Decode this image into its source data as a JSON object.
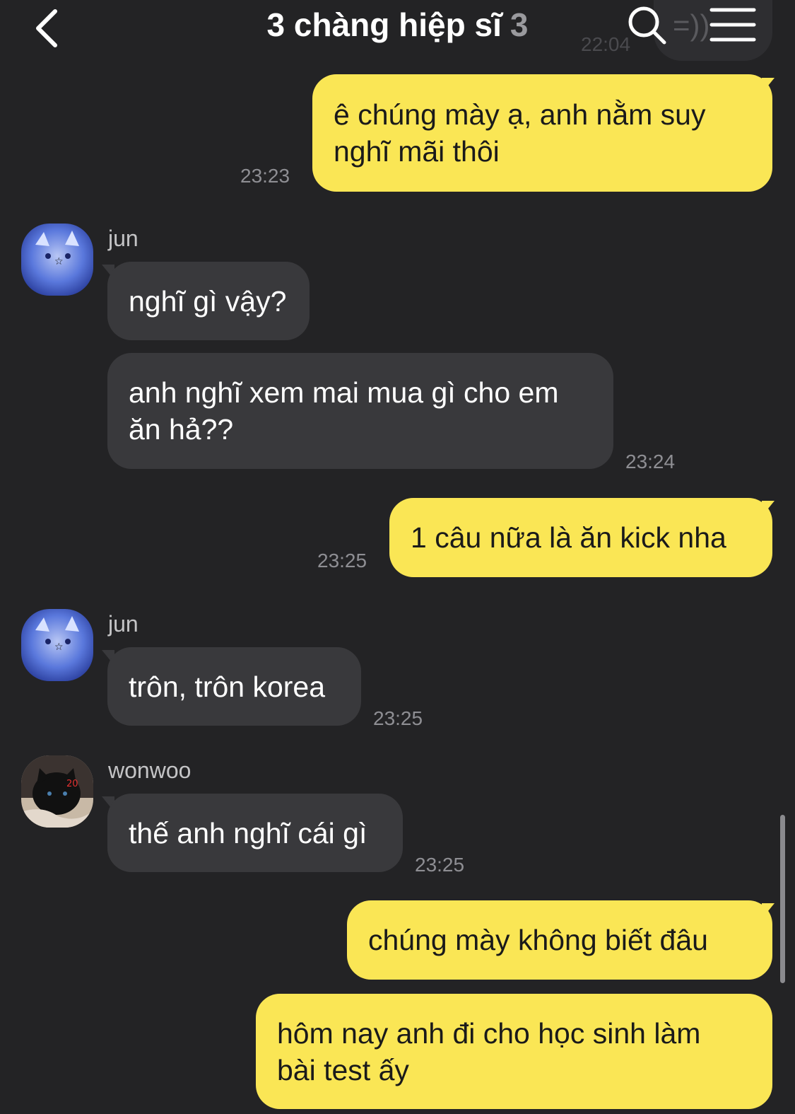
{
  "header": {
    "title": "3 chàng hiệp sĩ",
    "member_count": "3",
    "back_icon": "chevron-left-icon",
    "search_icon": "search-icon",
    "menu_icon": "hamburger-menu-icon"
  },
  "ghost": {
    "time": "22:04",
    "text": "=))"
  },
  "messages": [
    {
      "from": "me",
      "lines": [
        "ê chúng mày ạ, anh nằm suy",
        "nghĩ mãi thôi"
      ],
      "time": "23:23"
    },
    {
      "from": "them",
      "sender": "jun",
      "lines": [
        "nghĩ gì vậy?"
      ]
    },
    {
      "from": "them",
      "lines": [
        "anh nghĩ xem mai mua gì cho em",
        "ăn hả??"
      ],
      "time": "23:24"
    },
    {
      "from": "me",
      "lines": [
        "1 câu nữa là ăn kick nha"
      ],
      "time": "23:25"
    },
    {
      "from": "them",
      "sender": "jun",
      "lines": [
        "trôn, trôn korea"
      ],
      "time": "23:25"
    },
    {
      "from": "them",
      "sender": "wonwoo",
      "lines": [
        "thế anh nghĩ cái gì"
      ],
      "time": "23:25"
    },
    {
      "from": "me",
      "lines": [
        "chúng mày không biết đâu"
      ]
    },
    {
      "from": "me",
      "lines": [
        "hôm nay anh đi cho học sinh làm",
        "bài test ấy"
      ]
    }
  ],
  "colors": {
    "background": "#232325",
    "my_bubble": "#fae655",
    "their_bubble": "#39393c",
    "time": "#8e8e93"
  }
}
